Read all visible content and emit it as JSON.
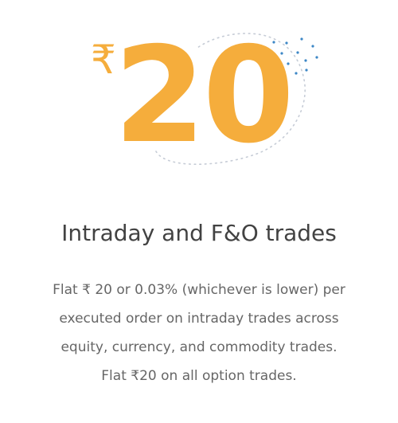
{
  "hero": {
    "currency_symbol": "₹",
    "amount": "20",
    "accent_color": "#f5ad3c",
    "dot_color": "#3d87c6",
    "ring_color": "#c6ccd6"
  },
  "card": {
    "title": "Intraday and F&O trades",
    "description_lines": [
      "Flat ₹ 20 or 0.03% (whichever is lower) per",
      "executed order on intraday trades across",
      "equity, currency, and commodity trades.",
      "Flat ₹20 on all option trades."
    ]
  }
}
